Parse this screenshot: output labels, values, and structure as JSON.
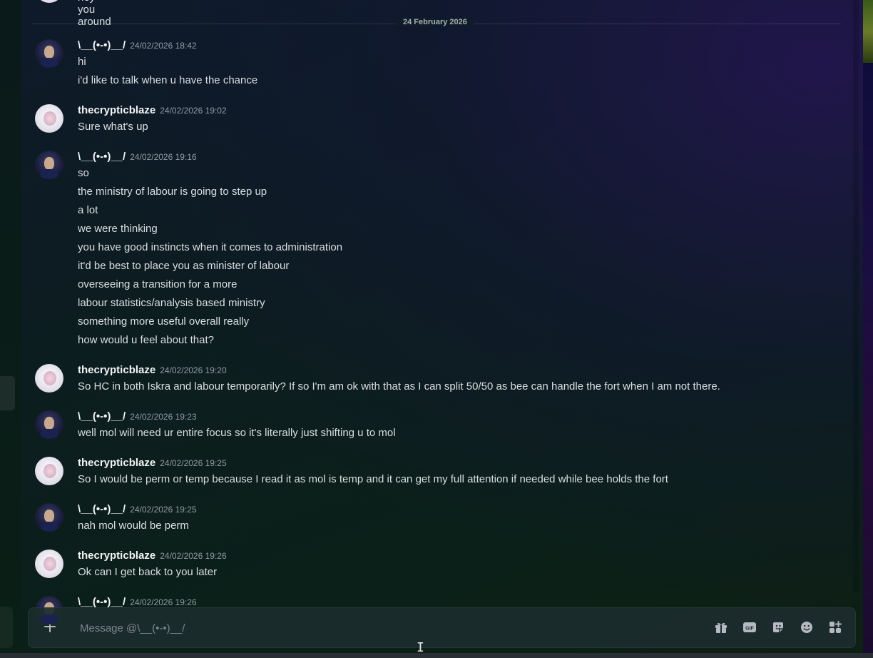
{
  "partial_top": {
    "text": "hey you around"
  },
  "date_divider": "24 February 2026",
  "messages": [
    {
      "author": "\\__(•-•)__/",
      "timestamp": "24/02/2026 18:42",
      "avatar": "user-avatar",
      "lines": [
        "hi",
        "i'd like to talk when u have the chance"
      ]
    },
    {
      "author": "thecrypticblaze",
      "timestamp": "24/02/2026 19:02",
      "avatar": "blaze-avatar",
      "lines": [
        "Sure what's up"
      ]
    },
    {
      "author": "\\__(•-•)__/",
      "timestamp": "24/02/2026 19:16",
      "avatar": "user-avatar",
      "lines": [
        "so",
        "the ministry of labour is going to step up",
        "a lot",
        "we were thinking",
        "you have good instincts when it comes to administration",
        "it'd be best to place you as minister of labour",
        "overseeing a transition for a more",
        "labour statistics/analysis based ministry",
        "something more useful overall really",
        "how would u feel about that?"
      ]
    },
    {
      "author": "thecrypticblaze",
      "timestamp": "24/02/2026 19:20",
      "avatar": "blaze-avatar",
      "lines": [
        "So HC in both Iskra and labour temporarily? If so I'm am ok with that as I can split 50/50 as bee can handle the fort when I am not there."
      ]
    },
    {
      "author": "\\__(•-•)__/",
      "timestamp": "24/02/2026 19:23",
      "avatar": "user-avatar",
      "lines": [
        "well mol will need ur entire focus so it's literally just shifting u to mol"
      ]
    },
    {
      "author": "thecrypticblaze",
      "timestamp": "24/02/2026 19:25",
      "avatar": "blaze-avatar",
      "lines": [
        "So I would be perm or temp because I read it as mol is temp and it can get my full attention if needed while bee holds the fort"
      ]
    },
    {
      "author": "\\__(•-•)__/",
      "timestamp": "24/02/2026 19:25",
      "avatar": "user-avatar",
      "lines": [
        "nah mol would be perm"
      ]
    },
    {
      "author": "thecrypticblaze",
      "timestamp": "24/02/2026 19:26",
      "avatar": "blaze-avatar",
      "lines": [
        "Ok can I get back to you later"
      ]
    },
    {
      "author": "\\__(•-•)__/",
      "timestamp": "24/02/2026 19:26",
      "avatar": "user-avatar",
      "lines": []
    }
  ],
  "composer": {
    "placeholder": "Message @\\__(•-•)__/",
    "value": "",
    "icons": [
      "gift-icon",
      "gif-icon",
      "sticker-icon",
      "emoji-icon",
      "apps-icon"
    ]
  }
}
